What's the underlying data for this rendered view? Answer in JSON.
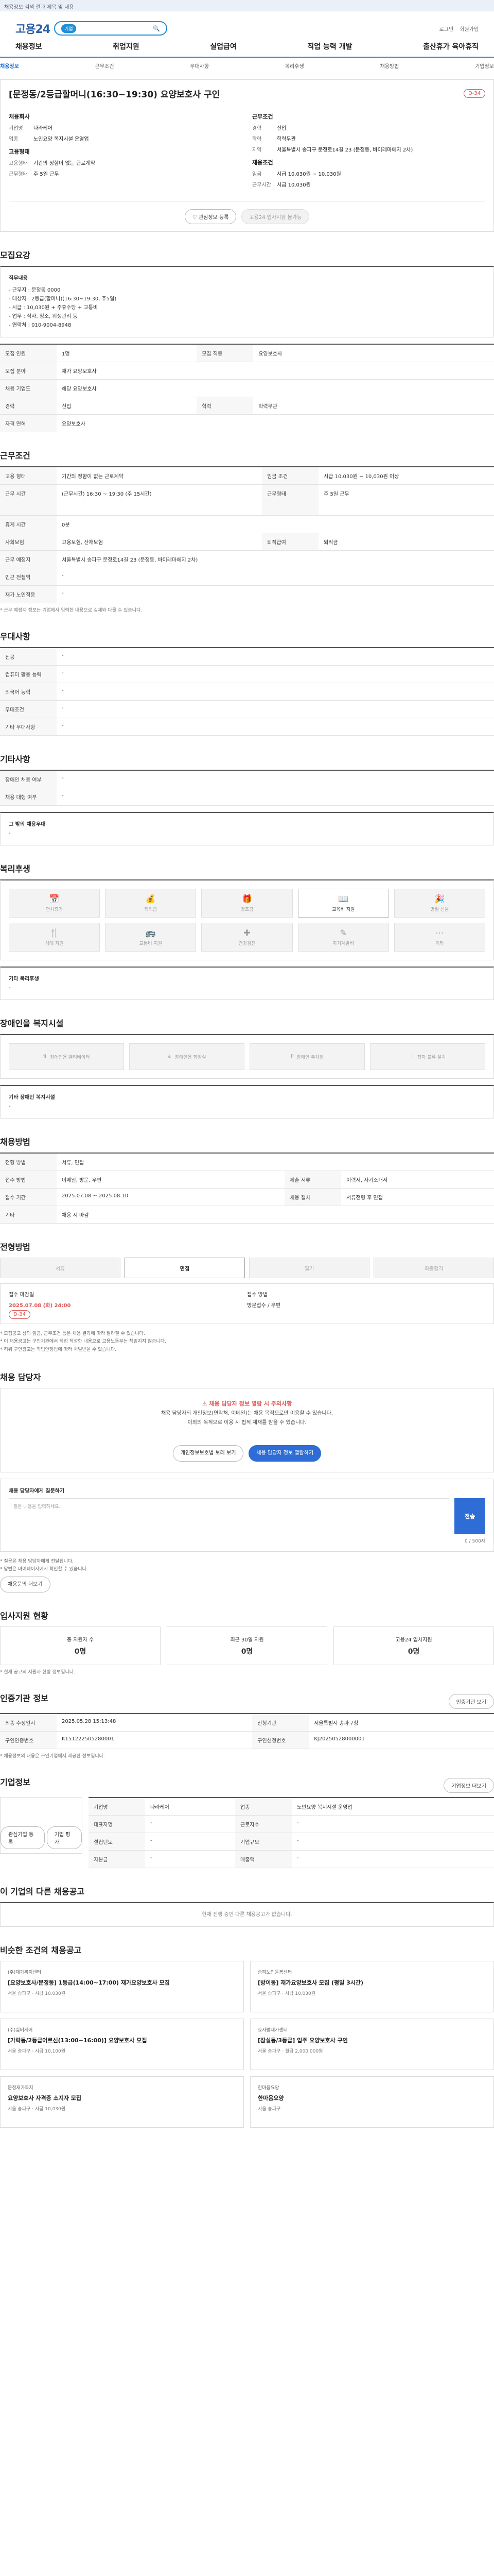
{
  "topbar": "채용정보 검색 결과 제목 및 내용",
  "header": {
    "logo": "고용24",
    "search_placeholder": "",
    "search_badge": "기업",
    "util": [
      "로그인",
      "회원가입"
    ]
  },
  "gnb": [
    "채용정보",
    "취업지원",
    "실업급여",
    "직업 능력 개발",
    "출산휴가 육아휴직"
  ],
  "subnav": [
    "채용정보",
    "근무조건",
    "우대사항",
    "복리후생",
    "채용방법",
    "기업정보"
  ],
  "job": {
    "title": "[문정동/2등급할머니(16:30~19:30) 요양보호사 구인",
    "dday": "D-34",
    "company_label": "채용회사",
    "company": [
      {
        "k": "기업명",
        "v": "나라케어"
      },
      {
        "k": "업종",
        "v": "노인요양 복지시설 운영업"
      }
    ],
    "work_label": "근무조건",
    "work": [
      {
        "k": "경력",
        "v": "신입"
      },
      {
        "k": "학력",
        "v": "학력무관"
      },
      {
        "k": "지역",
        "v": "서울특별시 송파구 문정로14길 23 (문정동, 바이레마에지 2차)"
      }
    ],
    "employ_label": "고용형태",
    "employ": [
      {
        "k": "고용형태",
        "v": "기간의 정함이 없는 근로계약"
      },
      {
        "k": "근무형태",
        "v": "주 5일 근무"
      }
    ],
    "salary_label": "채용조건",
    "salary": [
      {
        "k": "임금",
        "v": "시급 10,030원 ~ 10,030원"
      },
      {
        "k": "근무시간",
        "v": "시급 10,030원"
      }
    ],
    "btn_scrap": "관심정보 등록",
    "btn_apply": "고용24 입사지원 불가능"
  },
  "recruit": {
    "title": "모집요강",
    "desc_title": "직무내용",
    "desc_lines": [
      "- 근무지 : 문정동 0000",
      "- 대상자 : 2등급(할머니)(16:30~19:30, 주5일)",
      "- 시급 : 10,030원 + 주휴수당 + 교통비",
      "- 업무 : 식사, 청소, 위생관리 등",
      "- 연락처 : 010-9004-8948"
    ],
    "rows": [
      [
        "모집 인원",
        "1명",
        "모집 직종",
        "요양보호사"
      ],
      [
        "모집 분야",
        "재가 요양보호사",
        "",
        ""
      ],
      [
        "채용 기업도",
        "해당 요양보호사",
        "",
        ""
      ],
      [
        "경력",
        "신입",
        "학력",
        "학력무관"
      ],
      [
        "자격 면허",
        "요양보호사",
        "",
        ""
      ]
    ]
  },
  "conditions": {
    "title": "근무조건",
    "rows": [
      [
        "고용 형태",
        "기간의 정함이 없는 근로계약",
        "임금 조건",
        "시급 10,030원 ~ 10,030원 이상"
      ],
      [
        "근무 시간",
        "(근무시간) 16:30 ~ 19:30 (주 15시간)",
        "근무형태",
        "주 5일 근무"
      ],
      [
        "휴게 시간",
        "0분",
        "",
        ""
      ],
      [
        "사회보험",
        "고용보험, 산재보험",
        "퇴직급여",
        "퇴직금"
      ],
      [
        "근무 예정지",
        "서울특별시 송파구 문정로14길 23 (문정동, 바이레마에지 2차)",
        "",
        ""
      ],
      [
        "인근 전철역",
        "-",
        "",
        ""
      ],
      [
        "재가 노인적응",
        "-",
        "",
        ""
      ]
    ],
    "note": "* 근무 예정지 정보는 기업에서 입력한 내용으로 실제와 다를 수 있습니다."
  },
  "prefer": {
    "title": "우대사항",
    "rows": [
      [
        "전공",
        "-"
      ],
      [
        "컴퓨터 활용 능력",
        "-"
      ],
      [
        "외국어 능력",
        "-"
      ],
      [
        "우대조건",
        "-"
      ],
      [
        "기타 우대사항",
        "-"
      ]
    ]
  },
  "extra": {
    "title": "기타사항",
    "rows": [
      [
        "장애인 채용 여부",
        "-"
      ],
      [
        "채용 대행 여부",
        "-"
      ]
    ],
    "sub_title": "그 밖의 채용우대",
    "sub_text": "-"
  },
  "welfare": {
    "title": "복리후생",
    "items": [
      {
        "label": "연차휴가",
        "on": false
      },
      {
        "label": "퇴직금",
        "on": false
      },
      {
        "label": "경조금",
        "on": false
      },
      {
        "label": "교육비 지원",
        "on": true
      },
      {
        "label": "명절 선물",
        "on": false
      },
      {
        "label": "식대 지원",
        "on": false
      },
      {
        "label": "교통비 지원",
        "on": false
      },
      {
        "label": "건강검진",
        "on": false
      },
      {
        "label": "자기계발비",
        "on": false
      },
      {
        "label": "기타",
        "on": false
      }
    ],
    "etc_title": "기타 복리후생",
    "etc_text": "-"
  },
  "disabled": {
    "title": "장애인을 복지시설",
    "items": [
      "장애인용 엘리베이터",
      "장애인용 화장실",
      "장애인 주차장",
      "점자 블록 설치"
    ],
    "etc_title": "기타 장애인 복지시설",
    "etc_text": "-"
  },
  "recruit_method": {
    "title": "채용방법",
    "rows": [
      [
        "전형 방법",
        "서류, 면접",
        "",
        ""
      ],
      [
        "접수 방법",
        "이메일, 방문, 우편",
        "제출 서류",
        "이력서, 자기소개서"
      ],
      [
        "접수 기간",
        "2025.07.08 ~ 2025.08.10",
        "채용 절차",
        "서류전형 후 면접"
      ],
      [
        "기타",
        "채용 시 마감",
        "",
        ""
      ]
    ]
  },
  "process": {
    "title": "전형방법",
    "steps": [
      {
        "label": "서류",
        "on": false
      },
      {
        "label": "면접",
        "on": true
      },
      {
        "label": "필기",
        "on": false
      },
      {
        "label": "최종합격",
        "on": false
      }
    ],
    "period_label": "접수 마감일",
    "period_value": "2025.07.08 (화) 24:00",
    "dday": "D-34",
    "right_label": "접수 방법",
    "right_value": "방문접수 / 우편",
    "notices": [
      "* 모집공고 상의 임금, 근무조건 등은 채용 결과에 따라 달라질 수 있습니다.",
      "* 이 채용공고는 구인기관에서 직접 작성한 내용으로 고용노동부는 책임지지 않습니다.",
      "* 허위 구인광고는 직업안정법에 따라 처벌받을 수 있습니다."
    ]
  },
  "contact": {
    "title": "채용 담당자",
    "warn": "채용 담당자 정보 열람 시 주의사항",
    "lines": [
      "채용 담당자의 개인정보(연락처, 이메일)는 채용 목적으로만 이용할 수 있습니다.",
      "이외의 목적으로 이용 시 법적 제재를 받을 수 있습니다."
    ],
    "btn_view": "개인정보보호법 보러 보기",
    "btn_contact": "채용 담당자 정보 열람하기",
    "inq_title": "채용 담당자에게 질문하기",
    "inq_placeholder": "질문 내용을 입력하세요.",
    "inq_btn": "전송",
    "inq_count": "0 / 500자",
    "inq_notes": [
      "* 질문은 채용 담당자에게 전달됩니다.",
      "* 답변은 마이페이지에서 확인할 수 있습니다."
    ],
    "inq_more": "채용문의 더보기"
  },
  "applicants": {
    "title": "입사지원 현황",
    "stats": [
      {
        "label": "총 지원자 수",
        "num": "0명"
      },
      {
        "label": "최근 30일 지원",
        "num": "0명"
      },
      {
        "label": "고용24 입사지원",
        "num": "0명"
      }
    ],
    "note": "* 현재 공고의 지원자 현황 정보입니다."
  },
  "info": {
    "title": "인증기관 정보",
    "btn": "인증기관 보기",
    "rows": [
      [
        "최종 수정일시",
        "2025.05.28 15:13:48",
        "신청기관",
        "서울특별시 송파구청"
      ],
      [
        "구인인증번호",
        "K151222505280001",
        "구인신청번호",
        "KJ20250528000001"
      ]
    ],
    "note": "* 채용정보의 내용은 구인기업에서 제공한 정보입니다."
  },
  "company": {
    "title": "기업정보",
    "btn": "기업정보 더보기",
    "rows": [
      [
        "기업명",
        "나라케어",
        "업종",
        "노인요양 복지시설 운영업"
      ],
      [
        "대표자명",
        "-",
        "근로자수",
        "-"
      ],
      [
        "설립년도",
        "-",
        "기업규모",
        "-"
      ],
      [
        "자본금",
        "-",
        "매출액",
        "-"
      ]
    ],
    "btns": [
      "관심기업 등록",
      "기업 평가"
    ]
  },
  "other": {
    "title": "이 기업의 다른 채용공고",
    "note": "현재 진행 중인 다른 채용공고가 없습니다."
  },
  "recommend": {
    "title": "비슷한 조건의 채용공고",
    "cards": [
      {
        "co": "(주)재가복지센터",
        "title": "[요양보호사/문정동] 1등급(14:00~17:00) 재가요양보호사 모집",
        "meta": "서울 송파구 · 시급 10,030원"
      },
      {
        "co": "송파노인돌봄센터",
        "title": "[방이동] 재가요양보호사 모집 (평일 3시간)",
        "meta": "서울 송파구 · 시급 10,030원"
      },
      {
        "co": "(주)실버케어",
        "title": "[가락동/2등급어르신(13:00~16:00)] 요양보호사 모집",
        "meta": "서울 송파구 · 시급 10,100원"
      },
      {
        "co": "효사랑재가센터",
        "title": "[잠실동/3등급] 입주 요양보호사 구인",
        "meta": "서울 송파구 · 월급 2,000,000원"
      },
      {
        "co": "문정재가복지",
        "title": "요양보호사 자격증 소지자 모집",
        "meta": "서울 송파구 · 시급 10,030원"
      },
      {
        "co": "한마음요양",
        "title": "한마음요양",
        "meta": "서울 송파구"
      }
    ]
  }
}
